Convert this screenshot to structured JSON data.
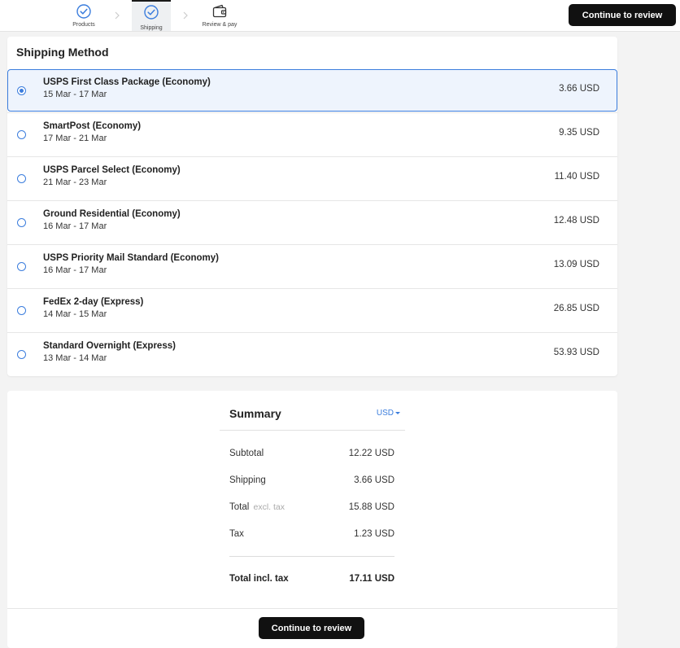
{
  "steps": [
    {
      "label": "Products",
      "icon": "check-circle-icon",
      "state": "done"
    },
    {
      "label": "Shipping",
      "icon": "check-circle-icon",
      "state": "active"
    },
    {
      "label": "Review & pay",
      "icon": "wallet-icon",
      "state": "upcoming"
    }
  ],
  "header": {
    "cta_label": "Continue to review"
  },
  "shipping": {
    "title": "Shipping Method",
    "options": [
      {
        "name": "USPS First Class Package (Economy)",
        "dates": "15 Mar - 17 Mar",
        "price": "3.66 USD",
        "selected": true
      },
      {
        "name": "SmartPost (Economy)",
        "dates": "17 Mar - 21 Mar",
        "price": "9.35 USD",
        "selected": false
      },
      {
        "name": "USPS Parcel Select (Economy)",
        "dates": "21 Mar - 23 Mar",
        "price": "11.40 USD",
        "selected": false
      },
      {
        "name": "Ground Residential (Economy)",
        "dates": "16 Mar - 17 Mar",
        "price": "12.48 USD",
        "selected": false
      },
      {
        "name": "USPS Priority Mail Standard (Economy)",
        "dates": "16 Mar - 17 Mar",
        "price": "13.09 USD",
        "selected": false
      },
      {
        "name": "FedEx 2-day (Express)",
        "dates": "14 Mar - 15 Mar",
        "price": "26.85 USD",
        "selected": false
      },
      {
        "name": "Standard Overnight (Express)",
        "dates": "13 Mar - 14 Mar",
        "price": "53.93 USD",
        "selected": false
      }
    ]
  },
  "summary": {
    "title": "Summary",
    "currency": "USD",
    "subtotal_label": "Subtotal",
    "subtotal_value": "12.22 USD",
    "shipping_label": "Shipping",
    "shipping_value": "3.66 USD",
    "total_excl_label": "Total",
    "total_excl_note": "excl. tax",
    "total_excl_value": "15.88 USD",
    "tax_label": "Tax",
    "tax_value": "1.23 USD",
    "total_incl_label": "Total incl. tax",
    "total_incl_value": "17.11 USD",
    "cta_label": "Continue to review"
  },
  "colors": {
    "accent": "#3b7ddd",
    "button": "#111111",
    "selected_bg": "#eef4fd"
  }
}
